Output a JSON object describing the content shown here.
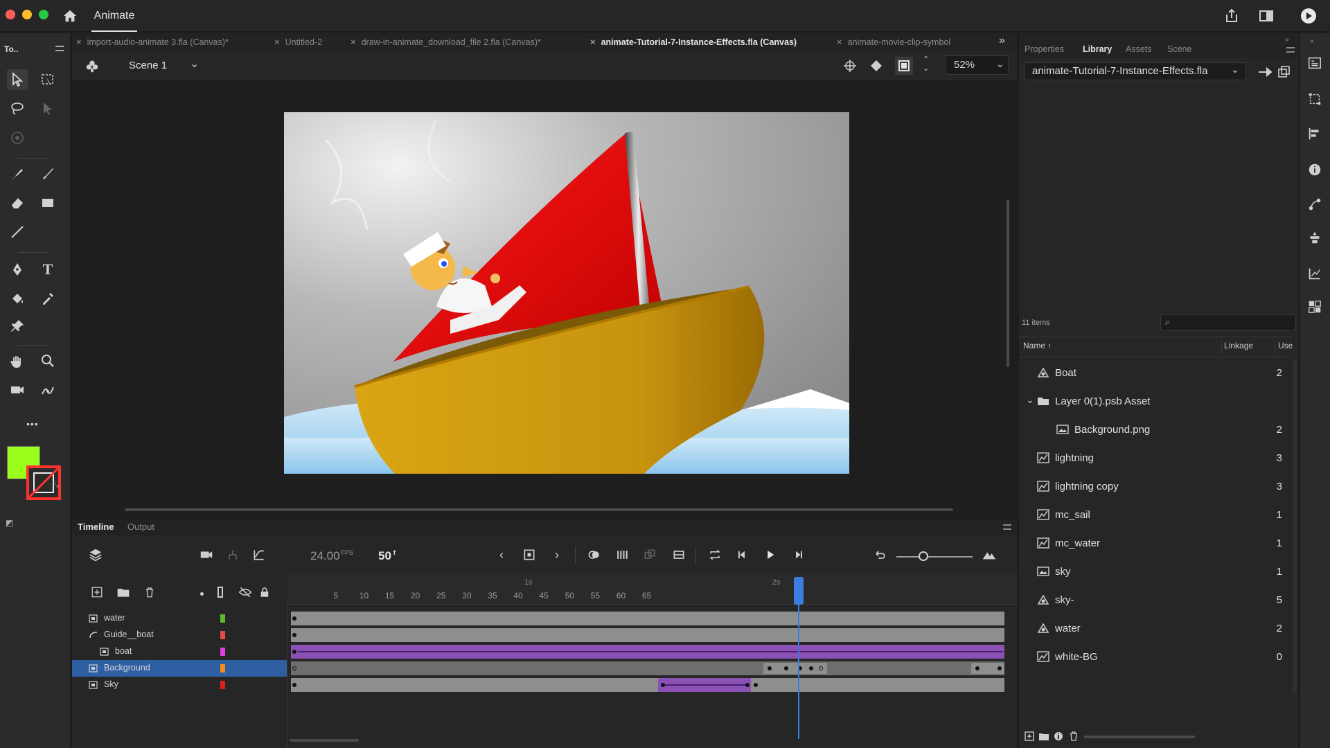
{
  "app": {
    "name": "Animate"
  },
  "tools_panel": {
    "title": "To..",
    "more": "•••",
    "fill_color": "#9aff1a",
    "stroke_color": "#ff3030"
  },
  "document_tabs": [
    {
      "label": "import-audio-animate 3.fla (Canvas)*",
      "active": false
    },
    {
      "label": "Untitled-2",
      "active": false
    },
    {
      "label": "draw-in-animate_download_file 2.fla (Canvas)*",
      "active": false
    },
    {
      "label": "animate-Tutorial-7-Instance-Effects.fla (Canvas)",
      "active": true
    },
    {
      "label": "animate-movie-clip-symbol",
      "active": false
    }
  ],
  "editbar": {
    "scene": "Scene 1",
    "zoom": "52%"
  },
  "timeline": {
    "tabs": [
      "Timeline",
      "Output"
    ],
    "fps": "24.00",
    "fps_unit": "FPS",
    "frame": "50",
    "frame_unit": "f",
    "seconds_markers": [
      "1s",
      "2s"
    ],
    "ruler": [
      "5",
      "10",
      "15",
      "20",
      "25",
      "30",
      "35",
      "40",
      "45",
      "50",
      "55",
      "60",
      "65"
    ],
    "current_frame": 50,
    "layers": [
      {
        "name": "water",
        "color": "#5fb82b",
        "selected": false,
        "indent": false
      },
      {
        "name": "Guide__boat",
        "color": "#e84a4a",
        "selected": false,
        "indent": false
      },
      {
        "name": "boat",
        "color": "#e040e0",
        "selected": false,
        "indent": true
      },
      {
        "name": "Background",
        "color": "#ff8a1c",
        "selected": true,
        "indent": false
      },
      {
        "name": "Sky",
        "color": "#e02020",
        "selected": false,
        "indent": false
      }
    ]
  },
  "right_panel": {
    "tabs": [
      {
        "label": "Properties",
        "active": false
      },
      {
        "label": "Library",
        "active": true
      },
      {
        "label": "Assets",
        "active": false
      },
      {
        "label": "Scene",
        "active": false
      }
    ],
    "library_file": "animate-Tutorial-7-Instance-Effects.fla",
    "item_count": "11 items",
    "columns": {
      "name": "Name",
      "linkage": "Linkage",
      "use": "Use"
    },
    "items": [
      {
        "name": "Boat",
        "use": "2",
        "icon": "graphic-symbol-icon",
        "indent": 0
      },
      {
        "name": "Layer 0(1).psb Asset",
        "use": "",
        "icon": "folder-icon",
        "indent": 0,
        "expanded": true
      },
      {
        "name": "Background.png",
        "use": "2",
        "icon": "bitmap-icon",
        "indent": 1
      },
      {
        "name": "lightning",
        "use": "3",
        "icon": "movieclip-icon",
        "indent": 0
      },
      {
        "name": "lightning copy",
        "use": "3",
        "icon": "movieclip-icon",
        "indent": 0
      },
      {
        "name": "mc_sail",
        "use": "1",
        "icon": "movieclip-icon",
        "indent": 0
      },
      {
        "name": "mc_water",
        "use": "1",
        "icon": "movieclip-icon",
        "indent": 0
      },
      {
        "name": "sky",
        "use": "1",
        "icon": "bitmap-icon",
        "indent": 0
      },
      {
        "name": "sky-",
        "use": "5",
        "icon": "graphic-symbol-icon",
        "indent": 0
      },
      {
        "name": "water",
        "use": "2",
        "icon": "graphic-symbol-icon",
        "indent": 0
      },
      {
        "name": "white-BG",
        "use": "0",
        "icon": "movieclip-icon",
        "indent": 0
      }
    ]
  }
}
